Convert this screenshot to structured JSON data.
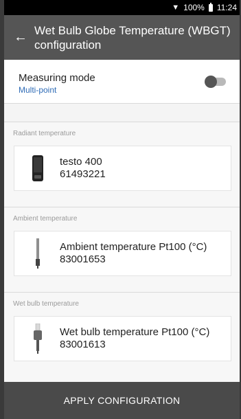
{
  "status": {
    "battery_text": "100%",
    "time": "11:24"
  },
  "appbar": {
    "title": "Wet Bulb Globe Temperature (WBGT) configuration"
  },
  "mode": {
    "label": "Measuring mode",
    "value": "Multi-point",
    "toggle_on": false
  },
  "sections": [
    {
      "label": "Radiant temperature",
      "device_name": "testo 400",
      "device_id": "61493221",
      "icon": "testo-400-device-icon"
    },
    {
      "label": "Ambient temperature",
      "device_name": "Ambient temperature Pt100 (°C)",
      "device_id": "83001653",
      "icon": "probe-icon"
    },
    {
      "label": "Wet bulb temperature",
      "device_name": "Wet bulb temperature Pt100 (°C)",
      "device_id": "83001613",
      "icon": "wet-bulb-probe-icon"
    }
  ],
  "footer": {
    "apply_label": "APPLY CONFIGURATION"
  },
  "colors": {
    "appbar": "#555555",
    "accent": "#2e6bb6",
    "footer": "#4a4a4a"
  }
}
